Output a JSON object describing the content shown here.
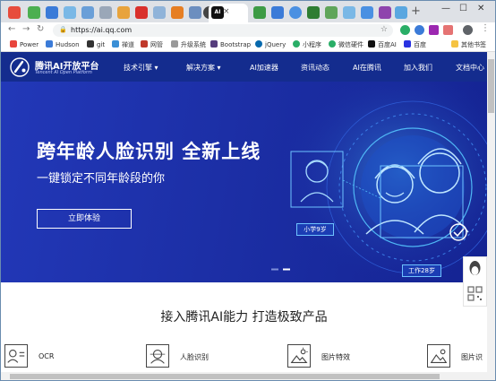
{
  "browser": {
    "url": "https://ai.qq.com",
    "active_tab_favicon": "AI",
    "new_tab_symbol": "+",
    "tab_close_symbol": "×",
    "window_controls": [
      "—",
      "☐",
      "✕"
    ]
  },
  "bookmarks": [
    {
      "label": "Power",
      "color": "#e8453c"
    },
    {
      "label": "Hudson",
      "color": "#3b7bd8"
    },
    {
      "label": "git",
      "color": "#333333"
    },
    {
      "label": "禅道",
      "color": "#3a8fd6"
    },
    {
      "label": "网管",
      "color": "#c0392b"
    },
    {
      "label": "升级系统",
      "color": "#999999"
    },
    {
      "label": "Bootstrap",
      "color": "#563d7c"
    },
    {
      "label": "jQuery",
      "color": "#0769ad"
    },
    {
      "label": "小程序",
      "color": "#2aae67"
    },
    {
      "label": "微信硬件",
      "color": "#2aae67"
    },
    {
      "label": "百度AI",
      "color": "#111111"
    },
    {
      "label": "百度",
      "color": "#2932e1"
    },
    {
      "label": "其他书签",
      "color": "#f5c342"
    }
  ],
  "site": {
    "logo_title": "腾讯AI开放平台",
    "logo_subtitle": "Tencent AI Open Platform",
    "menu": [
      "技术引擎 ▾",
      "解决方案 ▾",
      "AI加速器",
      "资讯动态",
      "AI在腾讯",
      "加入我们",
      "文档中心"
    ],
    "hero": {
      "title": "跨年龄人脸识别  全新上线",
      "subtitle": "一键锁定不同年龄段的你",
      "button": "立即体验",
      "tag_child": "小学9岁",
      "tag_adult": "工作28岁"
    },
    "slogan": "接入腾讯AI能力 打造极致产品",
    "products": [
      "OCR",
      "人脸识别",
      "图片特效",
      "图片识"
    ]
  },
  "colors": {
    "header_bg": "#142c8e",
    "hero_bg": "#1f33ac",
    "accent": "#4fb7f5"
  }
}
